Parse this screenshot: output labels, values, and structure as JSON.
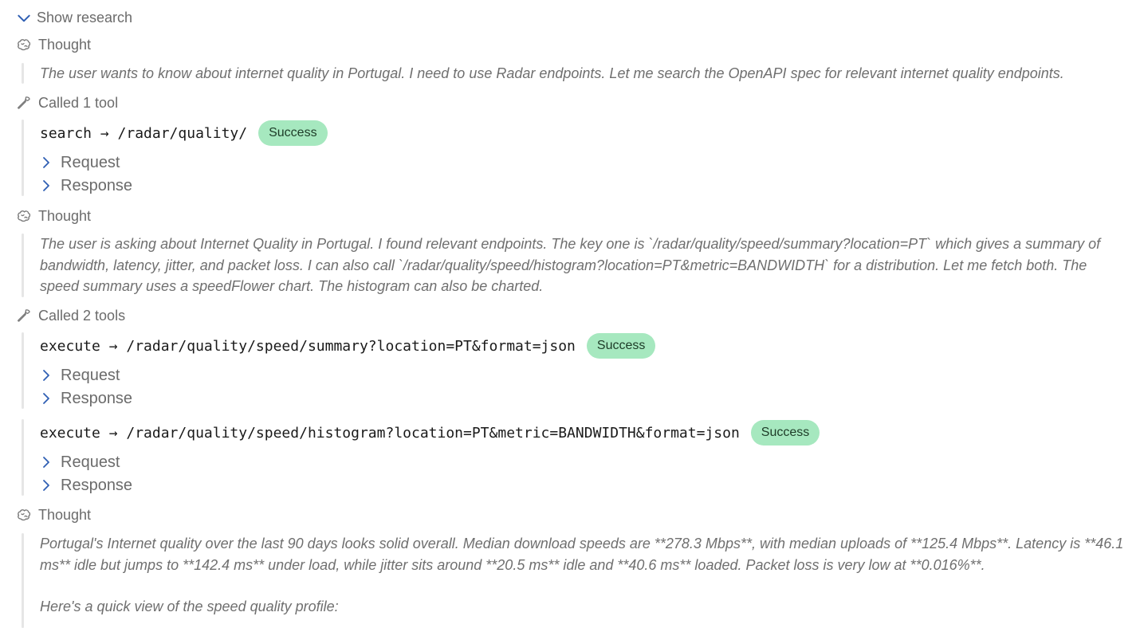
{
  "header": {
    "toggle_label": "Show research"
  },
  "steps": {
    "thought1": {
      "label": "Thought",
      "text": "The user wants to know about internet quality in Portugal. I need to use Radar endpoints. Let me search the OpenAPI spec for relevant internet quality endpoints."
    },
    "tools1": {
      "label": "Called 1 tool",
      "calls": [
        {
          "command": "search → /radar/quality/",
          "status": "Success",
          "request_label": "Request",
          "response_label": "Response"
        }
      ]
    },
    "thought2": {
      "label": "Thought",
      "text": "The user is asking about Internet Quality in Portugal. I found relevant endpoints. The key one is `/radar/quality/speed/summary?location=PT` which gives a summary of bandwidth, latency, jitter, and packet loss. I can also call `/radar/quality/speed/histogram?location=PT&metric=BANDWIDTH` for a distribution. Let me fetch both. The speed summary uses a speedFlower chart. The histogram can also be charted."
    },
    "tools2": {
      "label": "Called 2 tools",
      "calls": [
        {
          "command": "execute → /radar/quality/speed/summary?location=PT&format=json",
          "status": "Success",
          "request_label": "Request",
          "response_label": "Response"
        },
        {
          "command": "execute → /radar/quality/speed/histogram?location=PT&metric=BANDWIDTH&format=json",
          "status": "Success",
          "request_label": "Request",
          "response_label": "Response"
        }
      ]
    },
    "thought3": {
      "label": "Thought",
      "text": "Portugal's Internet quality over the last 90 days looks solid overall. Median download speeds are **278.3 Mbps**, with median uploads of **125.4 Mbps**. Latency is **46.1 ms** idle but jumps to **142.4 ms** under load, while jitter sits around **20.5 ms** idle and **40.6 ms** loaded. Packet loss is very low at **0.016%**.",
      "text2": "Here's a quick view of the speed quality profile:"
    }
  },
  "icons": {
    "toggle": "chevron-down-icon",
    "thought": "brain-icon",
    "tool": "wrench-icon",
    "expand": "chevron-right-icon"
  },
  "colors": {
    "success_bg": "#a6e8bf",
    "accent_chevron": "#2f5fb3"
  }
}
